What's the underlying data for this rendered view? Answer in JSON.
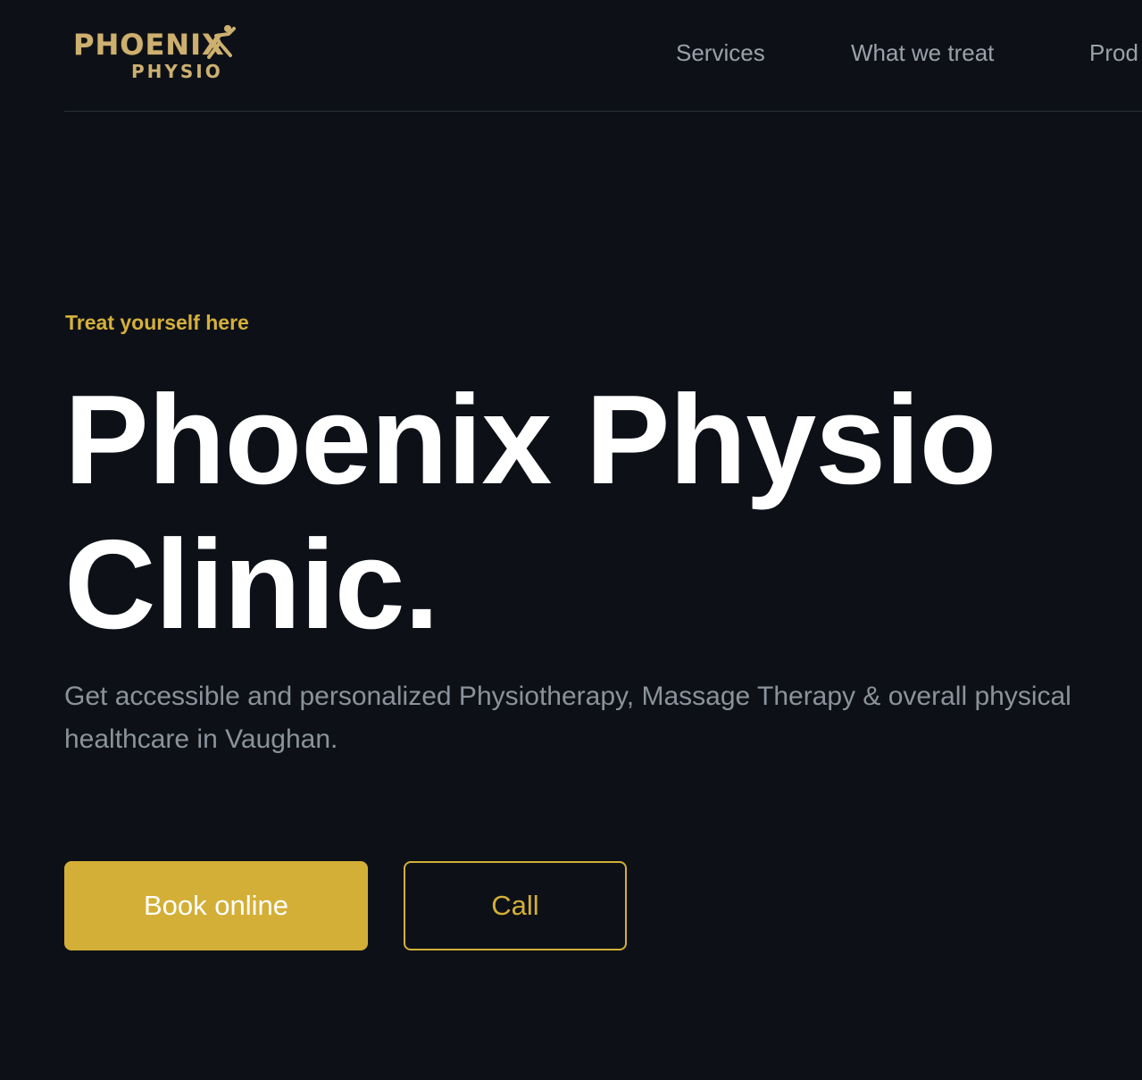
{
  "header": {
    "logo": {
      "line1": "PHOENIX",
      "line2": "PHYSIO"
    },
    "nav": [
      {
        "label": "Services"
      },
      {
        "label": "What we treat"
      },
      {
        "label": "Prod"
      }
    ]
  },
  "hero": {
    "eyebrow": "Treat yourself here",
    "title": "Phoenix Physio Clinic.",
    "subtitle": "Get accessible and personalized Physiotherapy, Massage Therapy & overall physical healthcare in Vaughan.",
    "buttons": {
      "primary": "Book online",
      "secondary": "Call"
    }
  },
  "colors": {
    "background": "#0d1117",
    "accent": "#d4af37",
    "muted_text": "#8b929b",
    "nav_text": "#9aa1ab"
  }
}
